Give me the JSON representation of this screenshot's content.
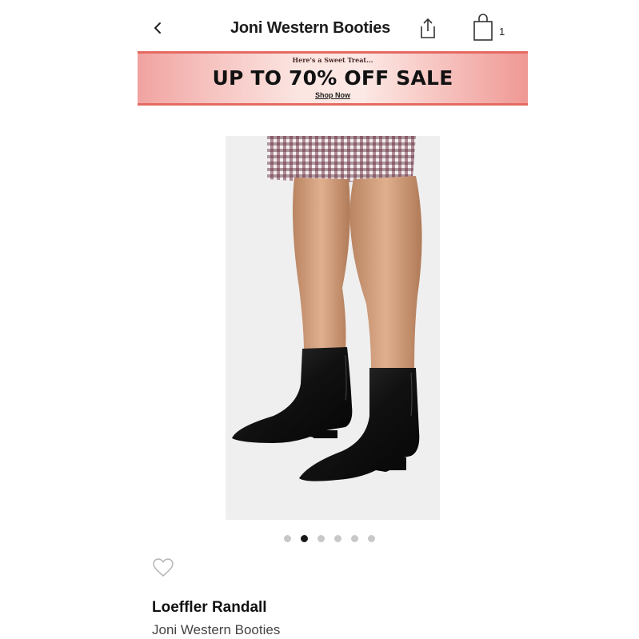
{
  "header": {
    "back_icon": "chevron-left-icon",
    "title": "Joni Western Booties",
    "share_icon": "share-icon",
    "bag_icon": "shopping-bag-icon",
    "bag_count": "1"
  },
  "banner": {
    "kicker": "Here's a Sweet Treat...",
    "headline": "UP TO 70% OFF SALE",
    "cta": "Shop Now"
  },
  "carousel": {
    "total": 6,
    "active_index": 1
  },
  "product": {
    "wishlist_icon": "heart-outline-icon",
    "brand": "Loeffler Randall",
    "name": "Joni Western Booties"
  },
  "colors": {
    "banner_accent": "#e56a62",
    "dot_active": "#1a1a1a",
    "dot_inactive": "#c8c8c8"
  }
}
